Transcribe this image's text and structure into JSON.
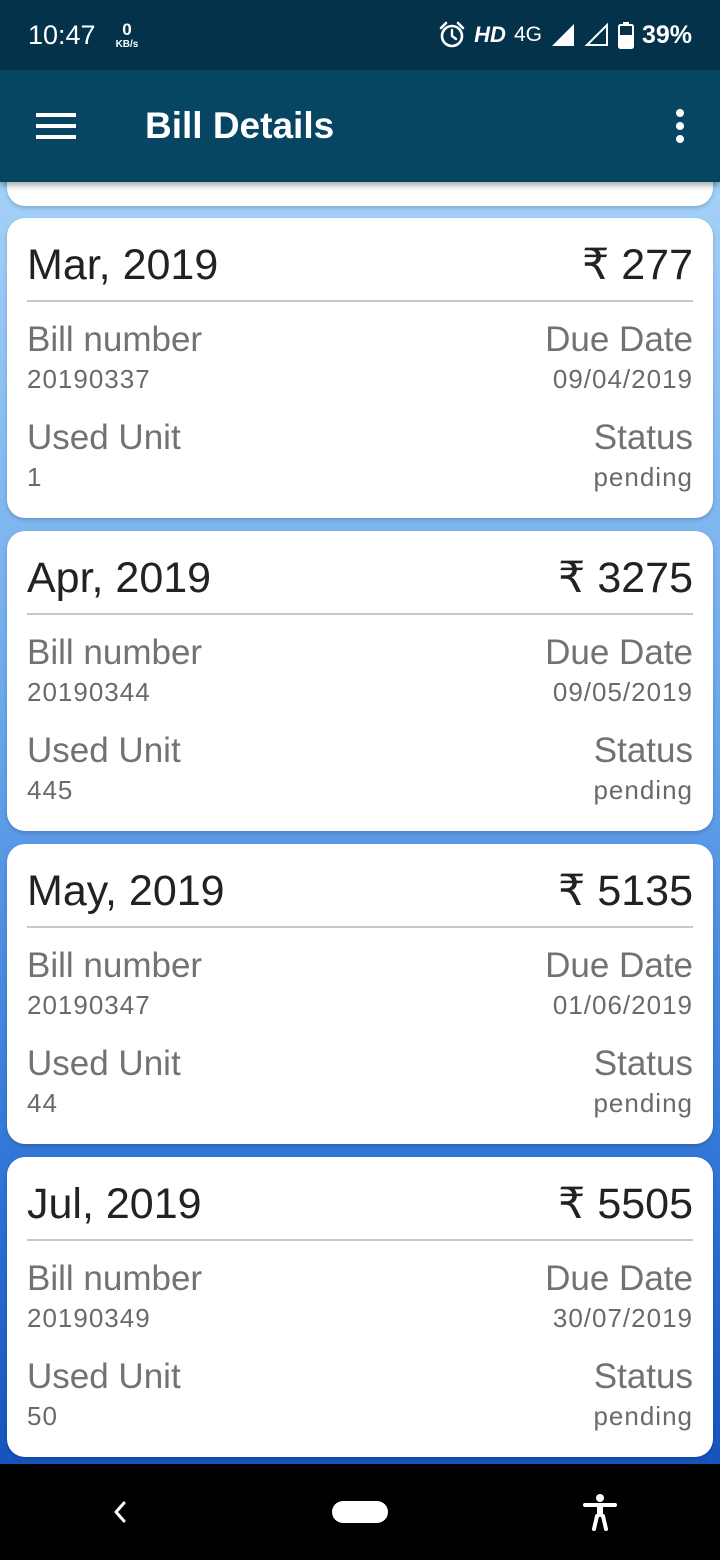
{
  "status_bar": {
    "time": "10:47",
    "speed_value": "0",
    "speed_unit": "KB/s",
    "hd": "HD",
    "network": "4G",
    "battery": "39%"
  },
  "app_bar": {
    "title": "Bill Details"
  },
  "bills": [
    {
      "period": "Mar, 2019",
      "amount": "₹ 277",
      "bill_number_label": "Bill number",
      "bill_number": "20190337",
      "due_date_label": "Due Date",
      "due_date": "09/04/2019",
      "used_unit_label": "Used Unit",
      "used_unit": "1",
      "status_label": "Status",
      "status": "pending"
    },
    {
      "period": "Apr, 2019",
      "amount": "₹ 3275",
      "bill_number_label": "Bill number",
      "bill_number": "20190344",
      "due_date_label": "Due Date",
      "due_date": "09/05/2019",
      "used_unit_label": "Used Unit",
      "used_unit": "445",
      "status_label": "Status",
      "status": "pending"
    },
    {
      "period": "May, 2019",
      "amount": "₹ 5135",
      "bill_number_label": "Bill number",
      "bill_number": "20190347",
      "due_date_label": "Due Date",
      "due_date": "01/06/2019",
      "used_unit_label": "Used Unit",
      "used_unit": "44",
      "status_label": "Status",
      "status": "pending"
    },
    {
      "period": "Jul, 2019",
      "amount": "₹ 5505",
      "bill_number_label": "Bill number",
      "bill_number": "20190349",
      "due_date_label": "Due Date",
      "due_date": "30/07/2019",
      "used_unit_label": "Used Unit",
      "used_unit": "50",
      "status_label": "Status",
      "status": "pending"
    }
  ],
  "icons": {
    "menu": "hamburger-icon",
    "more": "more-vert-icon",
    "back": "back-icon",
    "home": "home-pill",
    "accessibility": "accessibility-icon"
  },
  "colors": {
    "status_bar": "#04324a",
    "app_bar": "#064663",
    "card": "#ffffff"
  }
}
